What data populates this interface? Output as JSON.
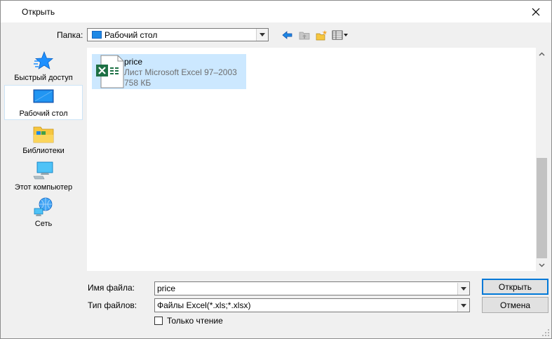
{
  "window": {
    "title": "Открыть"
  },
  "folder": {
    "label": "Папка:",
    "current": "Рабочий стол"
  },
  "toolbar": {
    "back_icon": "back-arrow-icon",
    "up_icon": "up-folder-icon",
    "new_folder_icon": "new-folder-icon",
    "view_icon": "view-menu-icon"
  },
  "places": [
    {
      "label": "Быстрый доступ",
      "icon": "quick-access-star-icon",
      "active": false
    },
    {
      "label": "Рабочий стол",
      "icon": "desktop-icon",
      "active": true
    },
    {
      "label": "Библиотеки",
      "icon": "libraries-icon",
      "active": false
    },
    {
      "label": "Этот компьютер",
      "icon": "computer-icon",
      "active": false
    },
    {
      "label": "Сеть",
      "icon": "network-icon",
      "active": false
    }
  ],
  "files": [
    {
      "name": "price",
      "type": "Лист Microsoft Excel 97–2003",
      "size": "758 КБ",
      "selected": true
    }
  ],
  "form": {
    "filename_label": "Имя файла:",
    "filename_value": "price",
    "filetype_label": "Тип файлов:",
    "filetype_value": "Файлы Excel(*.xls;*.xlsx)",
    "readonly_label": "Только чтение",
    "readonly_checked": false
  },
  "buttons": {
    "open": "Открыть",
    "cancel": "Отмена"
  },
  "colors": {
    "selection": "#cce8ff",
    "accent": "#0078d7",
    "excel_green": "#1d7044"
  }
}
